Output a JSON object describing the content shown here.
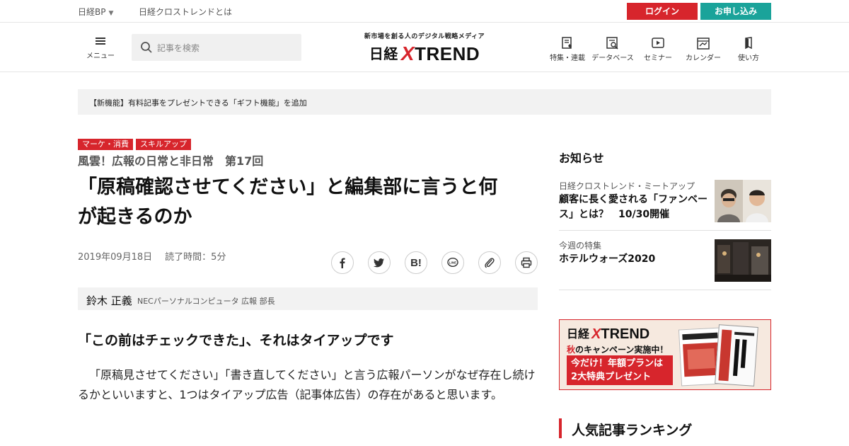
{
  "topbar": {
    "nikkei_bp": "日経BP",
    "about": "日経クロストレンドとは",
    "login": "ログイン",
    "signup": "お申し込み"
  },
  "header": {
    "menu_label": "メニュー",
    "search_placeholder": "記事を検索",
    "logo_tagline": "新市場を創る人のデジタル戦略メディア",
    "logo_nikkei": "日経",
    "logo_x": "X",
    "logo_trend": "TREND",
    "nav": [
      {
        "label": "特集・連載",
        "icon": "feature-icon"
      },
      {
        "label": "データベース",
        "icon": "database-icon"
      },
      {
        "label": "セミナー",
        "icon": "seminar-icon"
      },
      {
        "label": "カレンダー",
        "icon": "calendar-icon"
      },
      {
        "label": "使い方",
        "icon": "guide-icon"
      }
    ]
  },
  "notice": "【新機能】有料記事をプレゼントできる「ギフト機能」を追加",
  "article": {
    "tags": [
      "マーケ・消費",
      "スキルアップ"
    ],
    "series": "風雲！広報の日常と非日常　第17回",
    "headline_line1": "「原稿確認させてください」と編集部に言うと何",
    "headline_line2": "が起きるのか",
    "date": "2019年09月18日",
    "read_time": "読了時間：5分",
    "share": [
      "facebook-icon",
      "twitter-icon",
      "hatena-bookmark-icon",
      "line-icon",
      "link-icon",
      "print-icon"
    ],
    "hatena_label": "B!",
    "author_name": "鈴木 正義",
    "author_role": "NECパーソナルコンピュータ 広報 部長",
    "subhead": "「この前はチェックできた」、それはタイアップです",
    "body": "「原稿見させてください」「書き直してください」と言う広報パーソンがなぜ存在し続けるかといいますと、1つはタイアップ広告（記事体広告）の存在があると思います。"
  },
  "sidebar": {
    "title": "お知らせ",
    "news": [
      {
        "category": "日経クロストレンド・ミートアップ",
        "title": "顧客に長く愛される「ファンベース」とは？　10/30開催"
      },
      {
        "category": "今週の特集",
        "title": "ホテルウォーズ2020"
      }
    ],
    "promo": {
      "nikkei": "日経",
      "x": "X",
      "trend": "TREND",
      "autumn": "秋",
      "campaign_rest": "のキャンペーン実施中！",
      "offer_line1": "今だけ！年額プランは",
      "offer_line2": "2大特典プレゼント"
    },
    "ranking_title": "人気記事ランキング"
  },
  "colors": {
    "accent_red": "#d7252c",
    "teal": "#1aa39a"
  }
}
